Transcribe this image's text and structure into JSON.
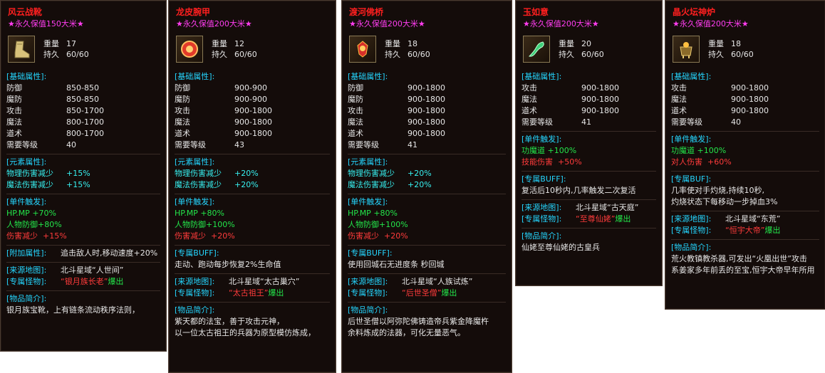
{
  "cards": [
    {
      "title": "风云战靴",
      "value": "★永久保值150大米★",
      "weight_label": "重量",
      "weight": "17",
      "dura_label": "持久",
      "dura": "60/60",
      "icon": "boot-icon",
      "basic_header": "[基础属性]:",
      "basic": [
        [
          "防御",
          "850-850"
        ],
        [
          "魔防",
          "850-850"
        ],
        [
          "攻击",
          "850-1700"
        ],
        [
          "魔法",
          "800-1700"
        ],
        [
          "道术",
          "800-1700"
        ],
        [
          "需要等级",
          "40"
        ]
      ],
      "elem_header": "[元素属性]:",
      "elem": [
        [
          "物理伤害减少",
          "+15%"
        ],
        [
          "魔法伤害减少",
          "+15%"
        ]
      ],
      "trig_header": "[单件触发]:",
      "trig": [
        [
          "HP.MP",
          "+70%"
        ],
        [
          "人物防御",
          "+80%"
        ],
        [
          "伤害减少",
          "+15%"
        ]
      ],
      "extra_header": "[附加属性]:",
      "extra_text": "追击敌人时,移动速度+20%",
      "src_map_label": "[来源地图]:",
      "src_map": "北斗星域“人世间”",
      "src_mon_label": "[专属怪物]:",
      "src_mon_name": "“银月族长老”",
      "src_mon_drop": "爆出",
      "intro_header": "[物品简介]:",
      "intro": [
        "银月族宝靴，上有链条流动秩序法则，"
      ]
    },
    {
      "title": "龙皮腕甲",
      "value": "★永久保值200大米★",
      "weight_label": "重量",
      "weight": "12",
      "dura_label": "持久",
      "dura": "60/60",
      "icon": "bracer-icon",
      "basic_header": "[基础属性]:",
      "basic": [
        [
          "防御",
          "900-900"
        ],
        [
          "魔防",
          "900-900"
        ],
        [
          "攻击",
          "900-1800"
        ],
        [
          "魔法",
          "900-1800"
        ],
        [
          "道术",
          "900-1800"
        ],
        [
          "需要等级",
          "43"
        ]
      ],
      "elem_header": "[元素属性]:",
      "elem": [
        [
          "物理伤害减少",
          "+20%"
        ],
        [
          "魔法伤害减少",
          "+20%"
        ]
      ],
      "trig_header": "[单件触发]:",
      "trig": [
        [
          "HP.MP",
          "+80%"
        ],
        [
          "人物防御",
          "+100%"
        ],
        [
          "伤害减少",
          "+20%"
        ]
      ],
      "buff_header": "[专属BUFF]:",
      "buff_text": [
        "走动、跑动每步恢复2%生命值"
      ],
      "src_map_label": "[来源地图]:",
      "src_map": "北斗星域“太古巢穴”",
      "src_mon_label": "[专属怪物]:",
      "src_mon_name": "“太古祖王”",
      "src_mon_drop": "爆出",
      "intro_header": "[物品简介]:",
      "intro": [
        "紫天都的法宝，善于攻击元神，",
        "以一位太古祖王的兵器为原型模仿炼成，"
      ]
    },
    {
      "title": "渡河佛桥",
      "value": "★永久保值200大米★",
      "weight_label": "重量",
      "weight": "18",
      "dura_label": "持久",
      "dura": "60/60",
      "icon": "orb-icon",
      "basic_header": "[基础属性]:",
      "basic": [
        [
          "防御",
          "900-1800"
        ],
        [
          "魔防",
          "900-1800"
        ],
        [
          "攻击",
          "900-1800"
        ],
        [
          "魔法",
          "900-1800"
        ],
        [
          "道术",
          "900-1800"
        ],
        [
          "需要等级",
          "41"
        ]
      ],
      "elem_header": "[元素属性]:",
      "elem": [
        [
          "物理伤害减少",
          "+20%"
        ],
        [
          "魔法伤害减少",
          "+20%"
        ]
      ],
      "trig_header": "[单件触发]:",
      "trig": [
        [
          "HP.MP",
          "+80%"
        ],
        [
          "人物防御",
          "+100%"
        ],
        [
          "伤害减少",
          "+20%"
        ]
      ],
      "buff_header": "[专属BUFF]:",
      "buff_text": [
        "使用回城石无进度条 秒回城"
      ],
      "src_map_label": "[来源地图]:",
      "src_map": "北斗星域“人族试炼”",
      "src_mon_label": "[专属怪物]:",
      "src_mon_name": "“后世圣僧”",
      "src_mon_drop": "爆出",
      "intro_header": "[物品简介]:",
      "intro": [
        "后世圣僧以阿弥陀佛铸造帝兵紫金降魔杵",
        "余料炼成的法器，可化无量恶气。"
      ]
    },
    {
      "title": "玉如意",
      "value": "★永久保值200大米★",
      "weight_label": "重量",
      "weight": "20",
      "dura_label": "持久",
      "dura": "60/60",
      "icon": "jade-ruyi-icon",
      "basic_header": "[基础属性]:",
      "basic": [
        [
          "攻击",
          "900-1800"
        ],
        [
          "魔法",
          "900-1800"
        ],
        [
          "道术",
          "900-1800"
        ],
        [
          "需要等级",
          "41"
        ]
      ],
      "trig_header": "[单件触发]:",
      "trig": [
        [
          "功魔道",
          "+100%"
        ],
        [
          "技能伤害",
          "+50%"
        ]
      ],
      "buff_header": "[专属BUFF]:",
      "buff_text": [
        "复活后10秒内,几率触发二次复活"
      ],
      "src_map_label": "[来源地图]:",
      "src_map": "北斗星域“古天庭”",
      "src_mon_label": "[专属怪物]:",
      "src_mon_name": "“至尊仙姥”",
      "src_mon_drop": "爆出",
      "intro_header": "[物品简介]:",
      "intro": [
        "仙姥至尊仙姥的古皇兵"
      ]
    },
    {
      "title": "晶火坛神炉",
      "value": "★永久保值200大米★",
      "weight_label": "重量",
      "weight": "18",
      "dura_label": "持久",
      "dura": "60/60",
      "icon": "furnace-icon",
      "basic_header": "[基础属性]:",
      "basic": [
        [
          "攻击",
          "900-1800"
        ],
        [
          "魔法",
          "900-1800"
        ],
        [
          "道术",
          "900-1800"
        ],
        [
          "需要等级",
          "40"
        ]
      ],
      "trig_header": "[单件触发]:",
      "trig": [
        [
          "功魔道",
          "+100%"
        ],
        [
          "对人伤害",
          "+60%"
        ]
      ],
      "buff_header": "[专属BUF]:",
      "buff_text": [
        "几率使对手灼烧,持续10秒,",
        "灼烧状态下每移动一步掉血3%"
      ],
      "src_map_label": "[来源地图]:",
      "src_map": "北斗星域“东荒”",
      "src_mon_label": "[专属怪物]:",
      "src_mon_name": "“恒宇大帝”",
      "src_mon_drop": "爆出",
      "intro_header": "[物品简介]:",
      "intro": [
        "荒火教镇教杀器,可发出“火凰出世”攻击",
        "系姜家多年前丢的至宝,恒宇大帝早年所用"
      ]
    }
  ]
}
